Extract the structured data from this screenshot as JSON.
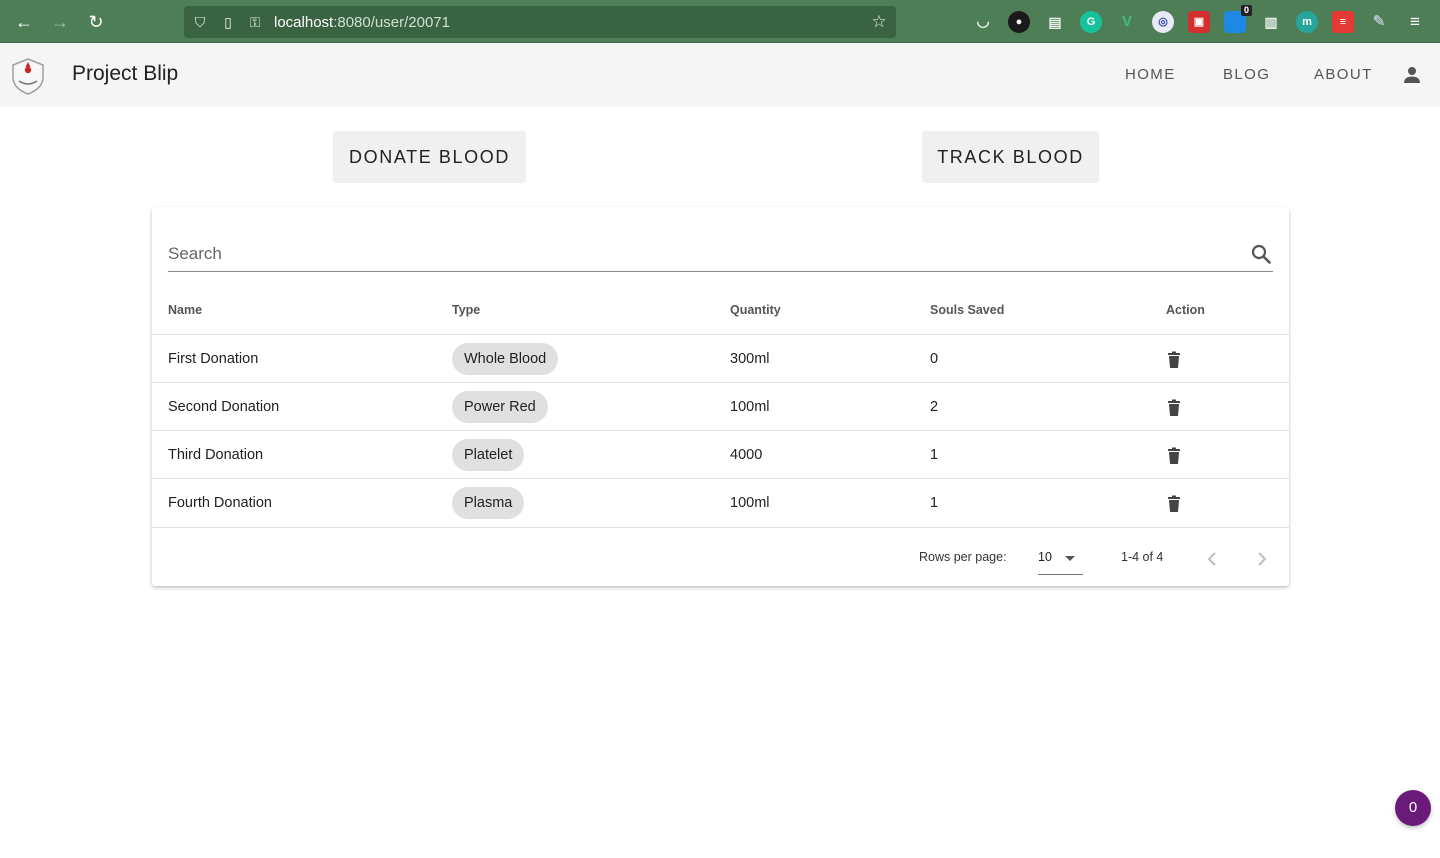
{
  "browser": {
    "url_host": "localhost",
    "url_path": ":8080/user/20071",
    "extension_badge": "0"
  },
  "app": {
    "title": "Project Blip",
    "nav": [
      "HOME",
      "BLOG",
      "ABOUT"
    ]
  },
  "actions": {
    "donate_label": "DONATE BLOOD",
    "track_label": "TRACK BLOOD"
  },
  "table": {
    "search_placeholder": "Search",
    "columns": [
      "Name",
      "Type",
      "Quantity",
      "Souls Saved",
      "Action"
    ],
    "rows": [
      {
        "name": "First Donation",
        "type": "Whole Blood",
        "quantity": "300ml",
        "souls_saved": "0"
      },
      {
        "name": "Second Donation",
        "type": "Power Red",
        "quantity": "100ml",
        "souls_saved": "2"
      },
      {
        "name": "Third Donation",
        "type": "Platelet",
        "quantity": "4000",
        "souls_saved": "1"
      },
      {
        "name": "Fourth Donation",
        "type": "Plasma",
        "quantity": "100ml",
        "souls_saved": "1"
      }
    ],
    "footer": {
      "rows_per_page_label": "Rows per page:",
      "rows_per_page_value": "10",
      "range_text": "1-4 of 4"
    }
  },
  "floating_badge": "0",
  "colors": {
    "browser_bar": "#4e7e56",
    "app_bar": "#f5f5f5",
    "chip": "#e0e0e0",
    "badge": "#6a1b7a"
  }
}
